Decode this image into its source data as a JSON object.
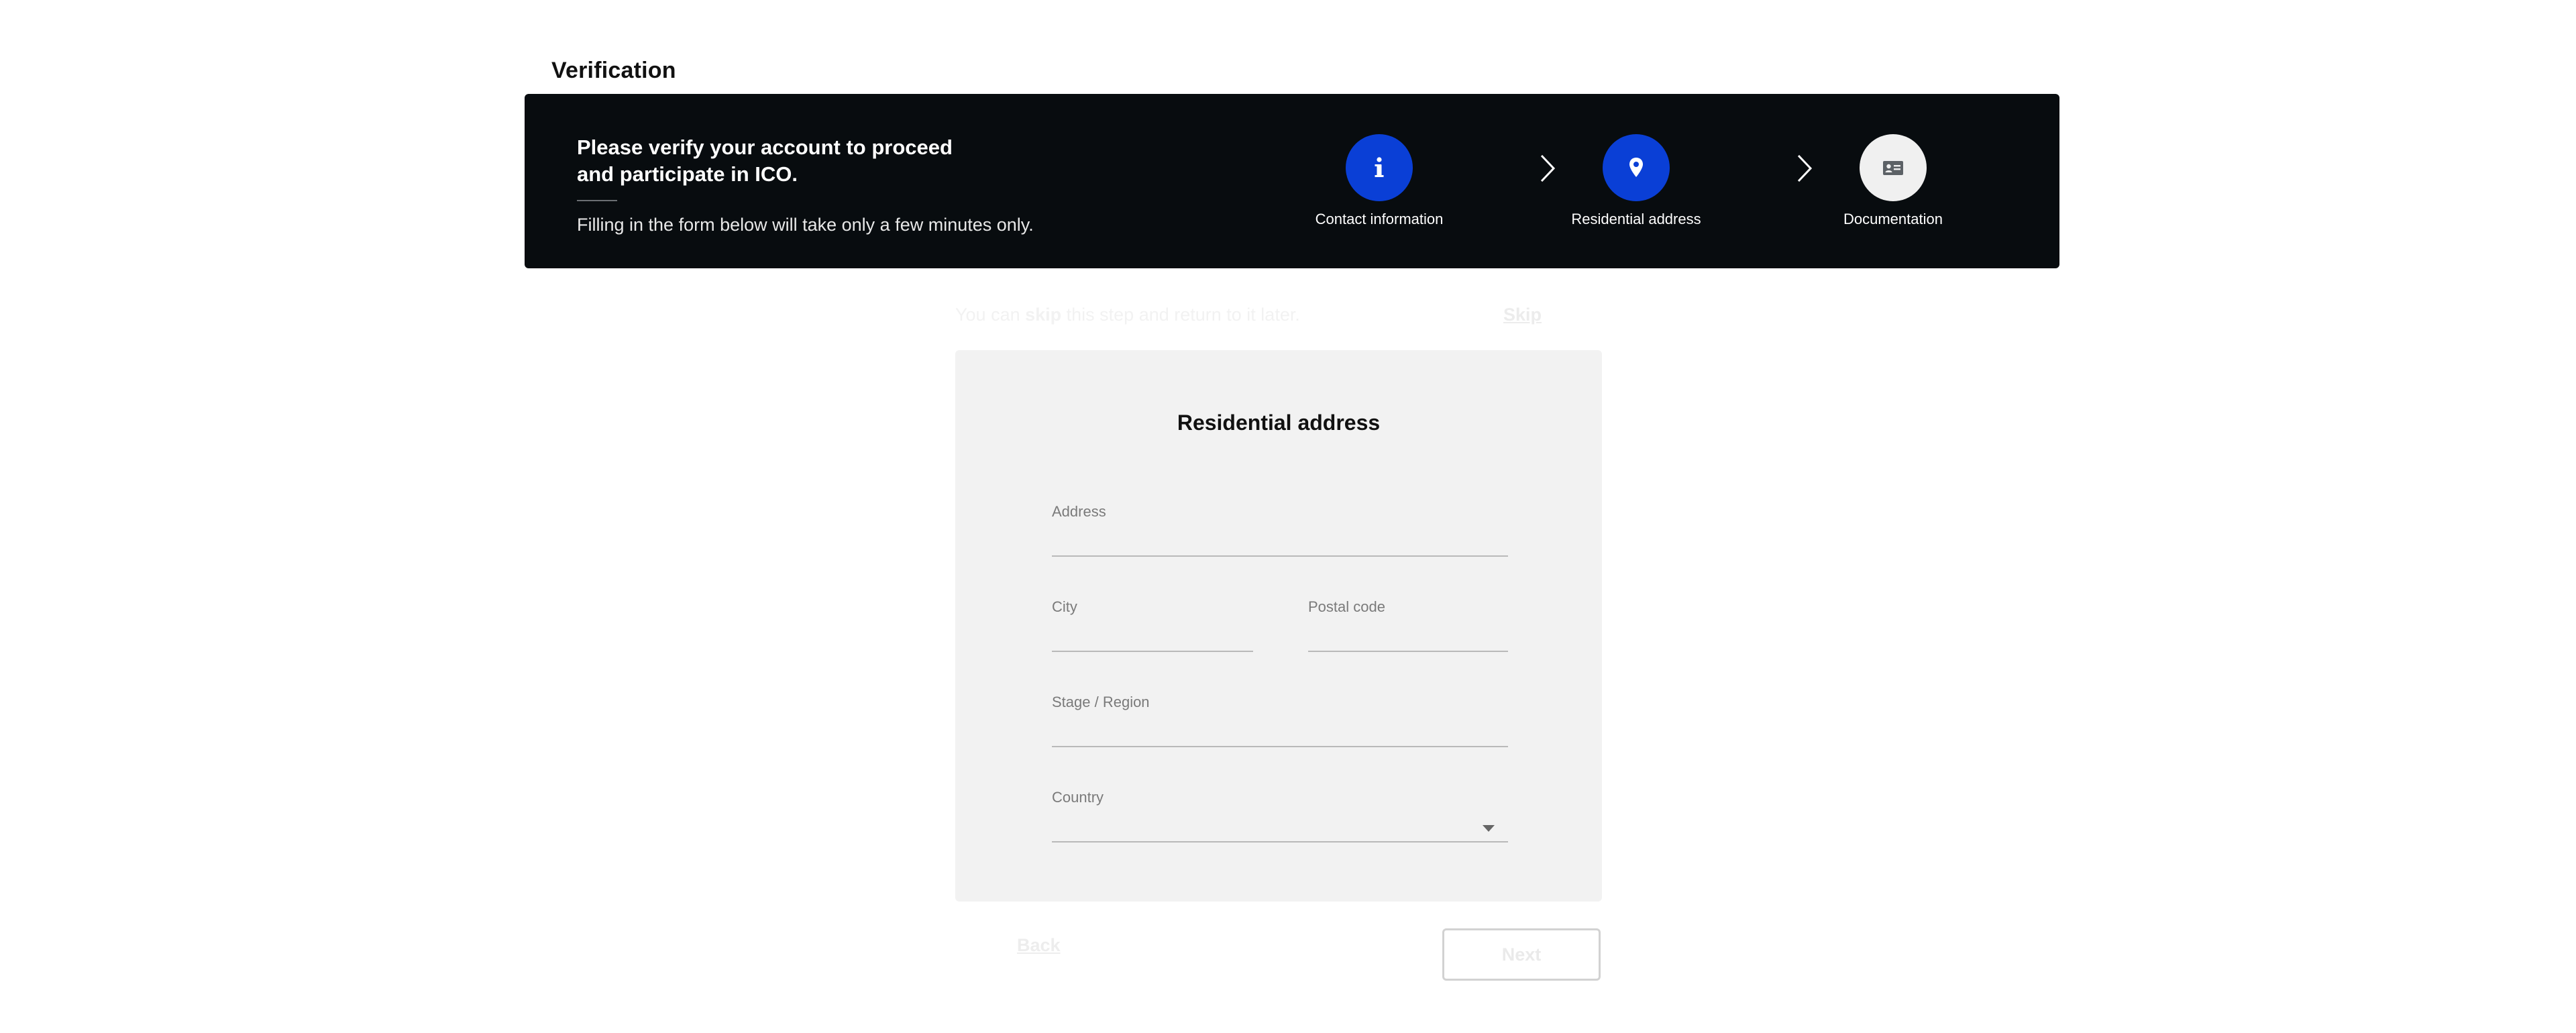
{
  "page": {
    "title": "Verification"
  },
  "banner": {
    "headline": "Please verify your account to proceed and participate in ICO.",
    "subtext": "Filling in the form below will take only a few minutes only.",
    "steps": [
      {
        "label": "Contact information",
        "icon": "info-icon",
        "state": "completed"
      },
      {
        "label": "Residential address",
        "icon": "location-pin-icon",
        "state": "active"
      },
      {
        "label": "Documentation",
        "icon": "id-card-icon",
        "state": "inactive"
      }
    ],
    "colors": {
      "background": "#080c0f",
      "active_step": "#0a3fd6",
      "inactive_step": "#f0f0f0"
    }
  },
  "skip": {
    "text_prefix": "You can ",
    "text_bold": "skip",
    "text_suffix": " this step and return to it later.",
    "link_label": "Skip"
  },
  "form": {
    "title": "Residential address",
    "fields": {
      "address": {
        "label": "Address",
        "value": ""
      },
      "city": {
        "label": "City",
        "value": ""
      },
      "postal_code": {
        "label": "Postal code",
        "value": ""
      },
      "region": {
        "label": "Stage / Region",
        "value": ""
      },
      "country": {
        "label": "Country",
        "value": ""
      }
    }
  },
  "nav": {
    "back_label": "Back",
    "next_label": "Next"
  }
}
